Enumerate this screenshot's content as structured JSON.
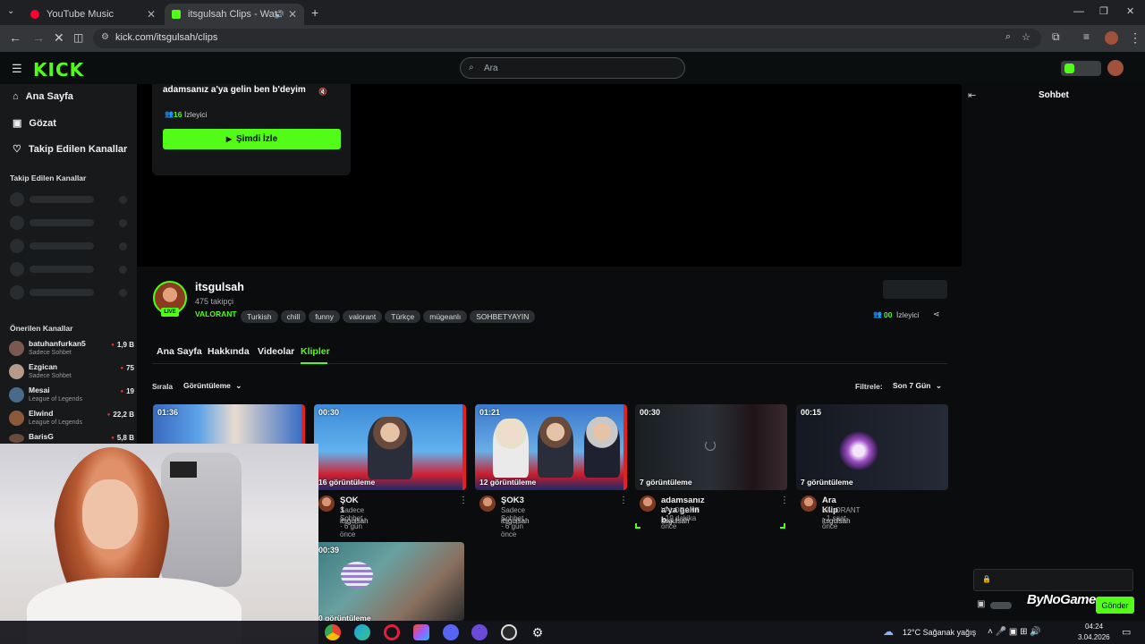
{
  "browser": {
    "tabs": [
      {
        "title": "YouTube Music",
        "active": false
      },
      {
        "title": "itsgulsah Clips - Watch Live",
        "active": true
      }
    ],
    "new_tab": "+",
    "url": "kick.com/itsgulsah/clips"
  },
  "header": {
    "logo": "KICK",
    "search_placeholder": "Ara"
  },
  "sidebar": {
    "nav": [
      {
        "label": "Ana Sayfa",
        "icon": "home-icon"
      },
      {
        "label": "Gözat",
        "icon": "browse-icon"
      },
      {
        "label": "Takip Edilen Kanallar",
        "icon": "heart-icon"
      }
    ],
    "followed_heading": "Takip Edilen Kanallar",
    "recommended_heading": "Önerilen Kanallar",
    "recommended": [
      {
        "name": "batuhanfurkan5",
        "category": "Sadece Sohbet",
        "viewers": "1,9 B"
      },
      {
        "name": "Ezgican",
        "category": "Sadece Sohbet",
        "viewers": "75"
      },
      {
        "name": "Mesai",
        "category": "League of Legends",
        "viewers": "19"
      },
      {
        "name": "Elwind",
        "category": "League of Legends",
        "viewers": "22,2 B"
      },
      {
        "name": "BarisG",
        "category": "",
        "viewers": "5,8 B"
      }
    ]
  },
  "offline_card": {
    "title": "adamsanız a'ya gelin ben b'deyim",
    "viewers_count": "16",
    "viewers_label": "İzleyici",
    "watch_button": "Şimdi İzle"
  },
  "channel": {
    "name": "itsgulsah",
    "followers": "475 takipçi",
    "live_badge": "LIVE",
    "category": "VALORANT",
    "tags": [
      "Turkish",
      "chill",
      "funny",
      "valorant",
      "Türkçe",
      "mügeanlı",
      "SOHBETYAYIN"
    ],
    "viewers_count": "00",
    "viewers_label": "İzleyici"
  },
  "channel_tabs": [
    "Ana Sayfa",
    "Hakkında",
    "Videolar",
    "Klipler"
  ],
  "sort": {
    "label": "Sırala",
    "value": "Görüntüleme"
  },
  "filter": {
    "label": "Filtrele:",
    "value": "Son 7 Gün"
  },
  "clips": [
    {
      "duration": "01:36",
      "views": "",
      "title": "",
      "category": "",
      "age": "",
      "user": ""
    },
    {
      "duration": "00:30",
      "views": "16 görüntüleme",
      "title": "ŞOK 1",
      "category": "Sadece Sohbet",
      "age": "6 gün önce",
      "user": "itsgulsah"
    },
    {
      "duration": "01:21",
      "views": "12 görüntüleme",
      "title": "ŞOK3",
      "category": "Sadece Sohbet",
      "age": "6 gün önce",
      "user": "itsgulsah"
    },
    {
      "duration": "00:30",
      "views": "7 görüntüleme",
      "title": "adamsanız a'ya gelin b...",
      "category": "VALORANT",
      "age": "19 dakika önce",
      "user": "itsgulsah"
    },
    {
      "duration": "00:15",
      "views": "7 görüntüleme",
      "title": "Ara Klip",
      "category": "VALORANT",
      "age": "1 saat önce",
      "user": "itsgulsah"
    },
    {
      "duration": "00:39",
      "views": "0 görüntüleme",
      "title": "",
      "category": "",
      "age": "",
      "user": ""
    }
  ],
  "chat": {
    "title": "Sohbet",
    "send_button": "Gönder",
    "watermark": "ByNoGame"
  },
  "taskbar": {
    "weather": "12°C Sağanak yağış",
    "time": "04:24",
    "date": "3.04.2026"
  },
  "colors": {
    "kick_green": "#53fc18",
    "bg": "#0b0c0d",
    "live_red": "#e33333"
  }
}
